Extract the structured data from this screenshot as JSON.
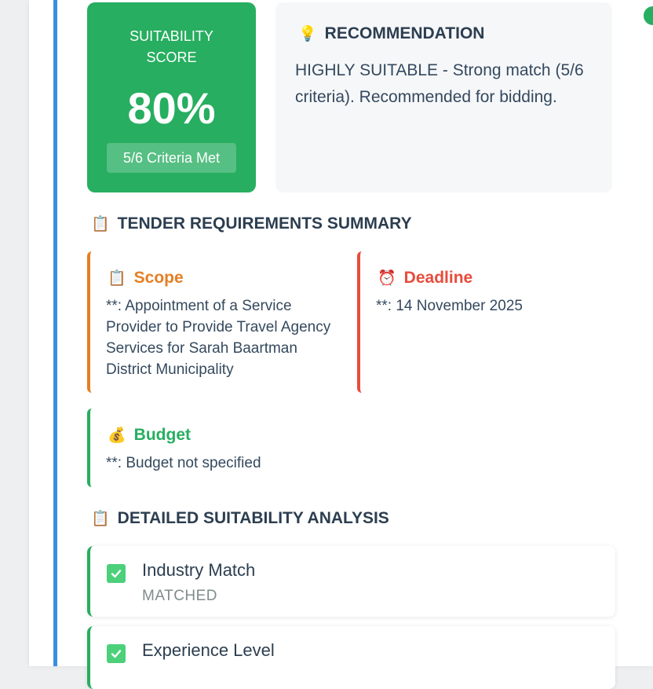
{
  "score": {
    "label": "SUITABILITY SCORE",
    "value": "80%",
    "criteria": "5/6 Criteria Met"
  },
  "recommendation": {
    "title": "RECOMMENDATION",
    "text": "HIGHLY SUITABLE - Strong match (5/6 criteria). Recommended for bidding."
  },
  "requirements": {
    "heading": "TENDER REQUIREMENTS SUMMARY",
    "scope": {
      "title": "Scope",
      "text": "**: Appointment of a Service Provider to Provide Travel Agency Services for Sarah Baartman District Municipality"
    },
    "deadline": {
      "title": "Deadline",
      "text": "**: 14 November 2025"
    },
    "budget": {
      "title": "Budget",
      "text": "**: Budget not specified"
    }
  },
  "analysis": {
    "heading": "DETAILED SUITABILITY ANALYSIS",
    "items": [
      {
        "label": "Industry Match",
        "status": "MATCHED"
      },
      {
        "label": "Experience Level",
        "status": ""
      }
    ]
  },
  "colors": {
    "accent_blue": "#3a8ee0",
    "score_green": "#27ae60",
    "scope_orange": "#e67e22",
    "deadline_red": "#e74c3c",
    "budget_green": "#27ae60"
  },
  "icons": {
    "recommendation": "lightbulb-icon",
    "clipboard": "clipboard-icon",
    "alarm": "alarm-clock-icon",
    "money": "money-bag-icon",
    "check": "check-box-icon"
  }
}
